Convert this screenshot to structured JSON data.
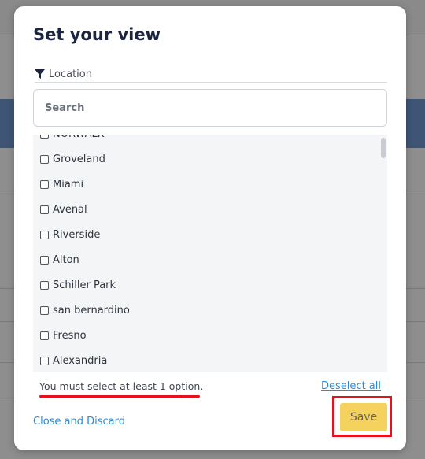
{
  "modal": {
    "title": "Set your view",
    "filter_label": "Location",
    "search_placeholder": "Search",
    "options": [
      "NORWALK",
      "Groveland",
      "Miami",
      "Avenal",
      "Riverside",
      "Alton",
      "Schiller Park",
      "san bernardino",
      "Fresno",
      "Alexandria"
    ],
    "warning": "You must select at least 1 option.",
    "deselect_all": "Deselect all",
    "close_discard": "Close and Discard",
    "save": "Save"
  },
  "colors": {
    "accent_link": "#2d8bd6",
    "save_button": "#f5d25e",
    "highlight": "#e8101c"
  }
}
